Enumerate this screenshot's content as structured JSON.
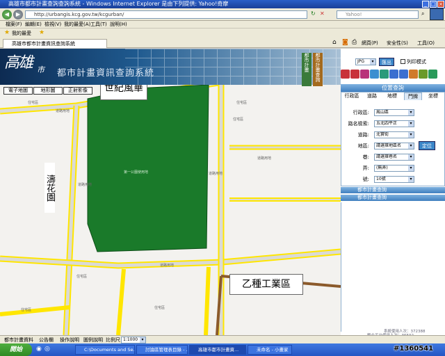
{
  "window": {
    "title": "高雄市都市計畫查詢查詢系統 - Windows Internet Explorer 是由下列提供: Yahoo!奇摩",
    "address": "http://urbangis.kcg.gov.tw/kcgurban/",
    "search_placeholder": "Yahoo!",
    "tab_label": "高雄市都市計畫資訊查詢系統"
  },
  "menu": [
    "檔案(F)",
    "編輯(E)",
    "檢視(V)",
    "我的最愛(A)",
    "工具(T)",
    "說明(H)"
  ],
  "favorites": {
    "label": "我的最愛"
  },
  "commands": {
    "page": "網頁(P)",
    "safety": "安全性(S)",
    "tools": "工具(O)"
  },
  "banner": {
    "logo": "高雄",
    "city": "市",
    "title": "都市計畫資訊查詢系統"
  },
  "map_tabs": [
    "電子地圖",
    "地形圖",
    "正射影像"
  ],
  "side_tabs": [
    "都市計畫",
    "都市計畫查詢"
  ],
  "toolbar": {
    "format": "JPG",
    "output_button": "匯出",
    "print_mode": "列印模式"
  },
  "query": {
    "title": "位置查詢",
    "tabs": [
      "行政區",
      "道路",
      "地標",
      "門牌",
      "坐標"
    ],
    "fields": [
      {
        "label": "行政區:",
        "value": "鳳山區"
      },
      {
        "label": "路名檢索:",
        "value": "五北四平正"
      },
      {
        "label": "道路:",
        "value": "北實街"
      },
      {
        "label": "地區:",
        "value": "請選擇地區名"
      },
      {
        "label": "巷:",
        "value": "請選擇巷名"
      },
      {
        "label": "弄:",
        "value": "(無弄)"
      },
      {
        "label": "號:",
        "value": "10號"
      }
    ],
    "locate_button": "定位"
  },
  "panels": [
    "都市計畫查詢",
    "都市計畫查詢"
  ],
  "visitors": {
    "line1": "系統使用人次：372388",
    "line2": "整合平台使用人次：36592"
  },
  "status": {
    "items": [
      "都市計畫資料",
      "公告欄",
      "操作說明",
      "圖例說明"
    ],
    "scale_label": "比例尺",
    "scale_value": "1:1000"
  },
  "map_labels": {
    "shiji": "世紀風華",
    "taohua": "濤花園",
    "industry": "乙種工業區",
    "park": "第一公園使用地",
    "residential": "住宅區",
    "road": "道路用地"
  },
  "taskbar": {
    "start": "開始",
    "tasks": [
      "C:\\Documents and Se...",
      "討論區管理表目錄 - ...",
      "高雄市都市計畫資...",
      "未命名 - 小畫家"
    ]
  },
  "watermark": "#1360541"
}
